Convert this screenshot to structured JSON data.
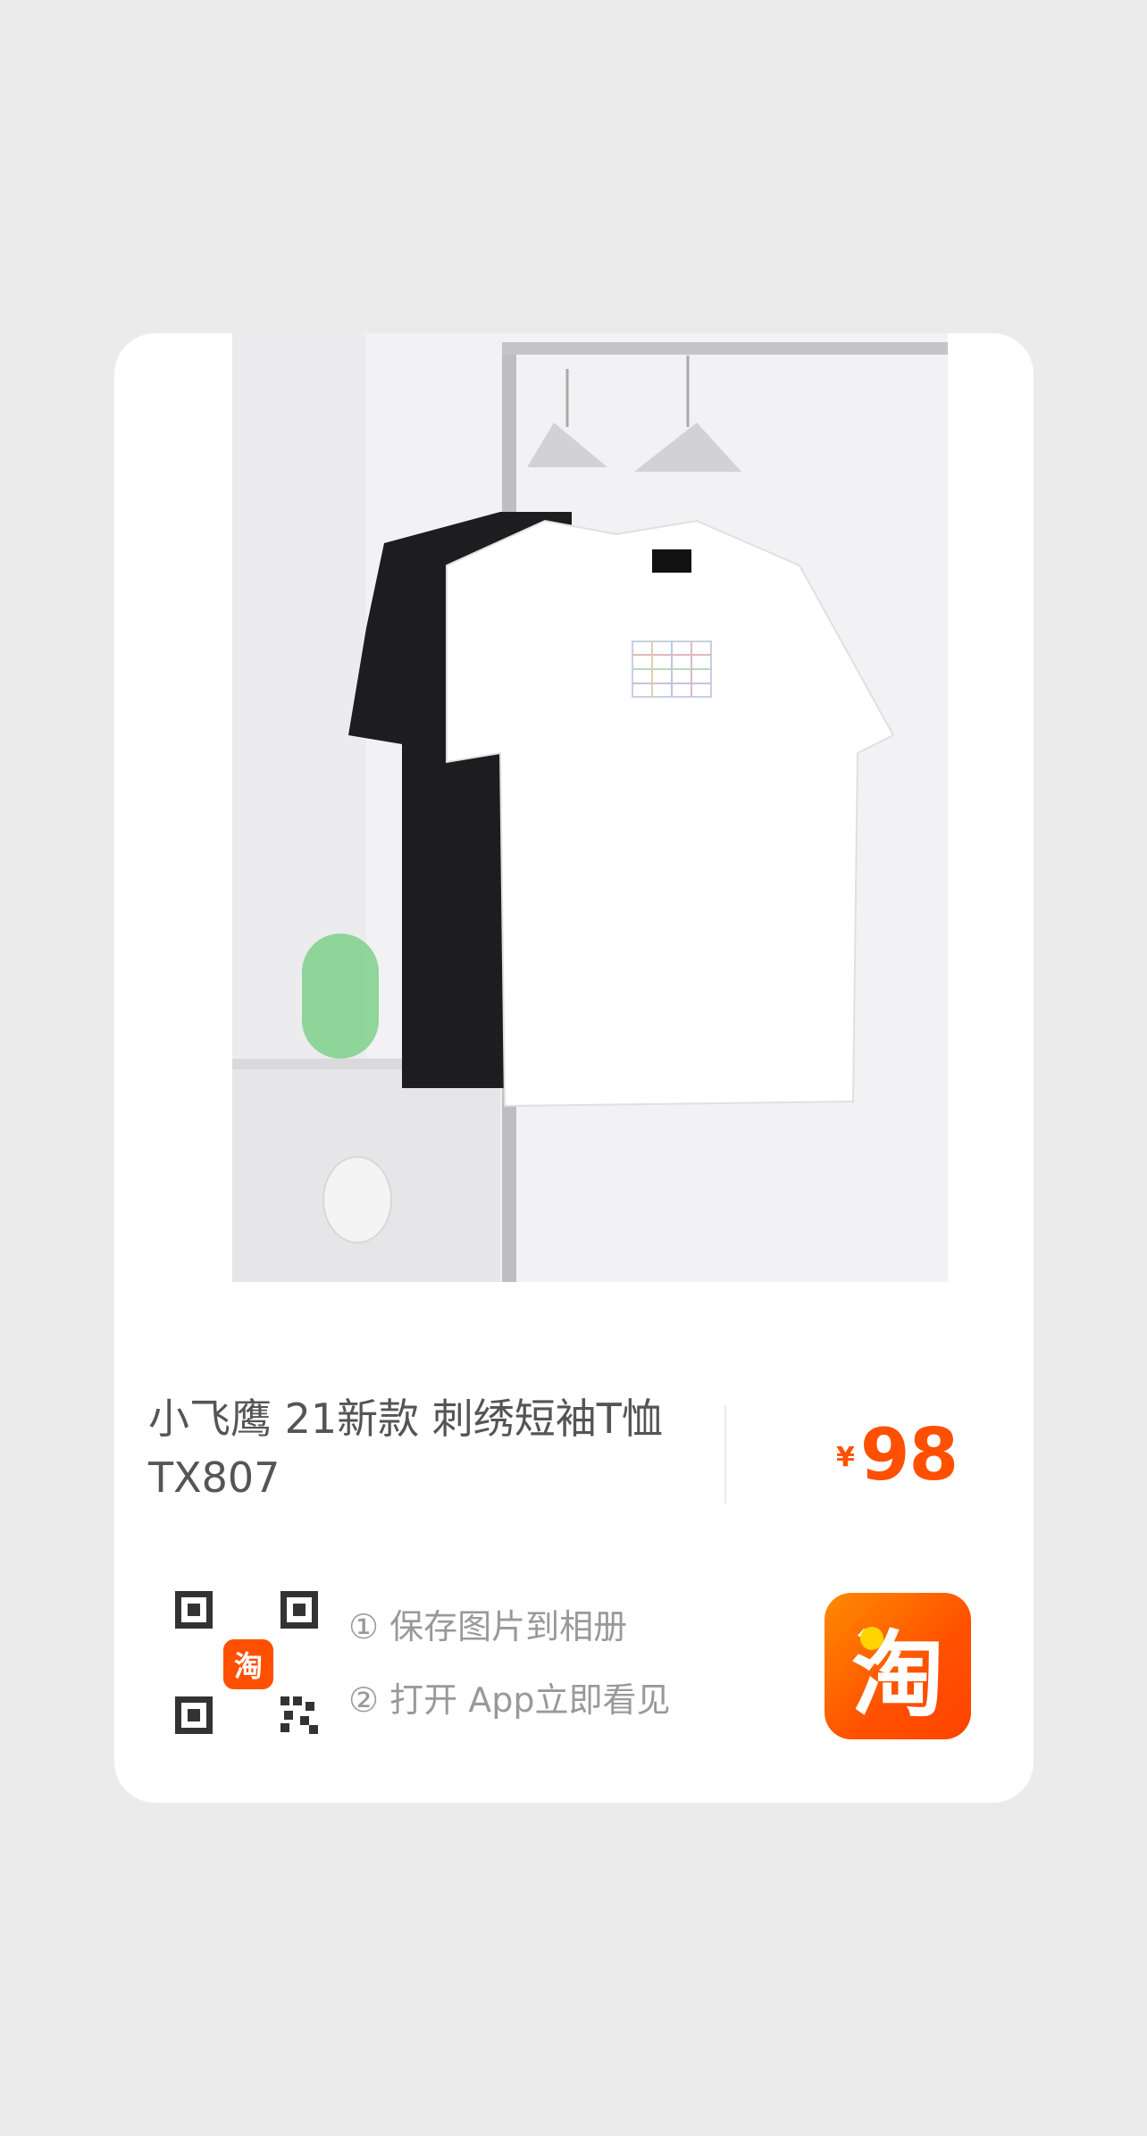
{
  "product": {
    "title": "小飞鹰 21新款 刺绣短袖T恤 TX807",
    "currency_symbol": "¥",
    "price": "98"
  },
  "share": {
    "qr_logo_text": "淘",
    "step1": "① 保存图片到相册",
    "step2": "② 打开 App立即看见"
  },
  "app_logo": {
    "text": "淘",
    "icon": "taobao-logo-icon"
  },
  "colors": {
    "accent": "#ff5000",
    "background": "#ebebeb",
    "card": "#ffffff"
  }
}
